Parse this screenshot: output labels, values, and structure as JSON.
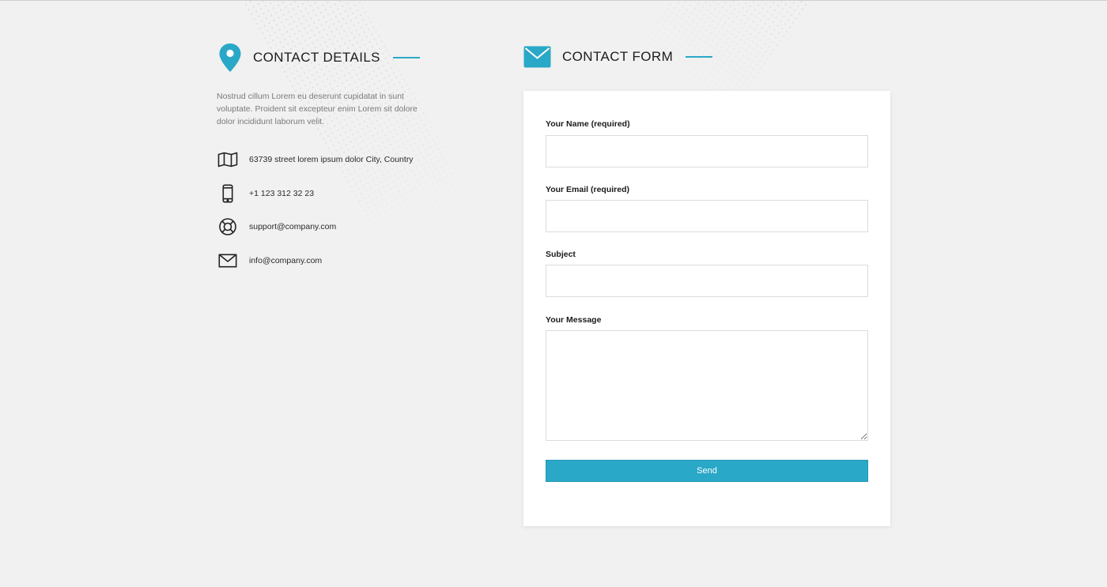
{
  "colors": {
    "accent": "#2aa8c7",
    "background": "#f1f1f1",
    "card": "#ffffff",
    "text_dark": "#1c1c1c",
    "text_muted": "#7a7a7a"
  },
  "contact_details": {
    "title": "CONTACT DETAILS",
    "icon": "map-pin-icon",
    "intro": "Nostrud cillum Lorem eu deserunt cupidatat in sunt voluptate. Proident sit excepteur enim Lorem sit dolore dolor incididunt laborum velit.",
    "items": [
      {
        "icon": "map-icon",
        "text": "63739 street lorem ipsum dolor City, Country"
      },
      {
        "icon": "mobile-phone-icon",
        "text": "+1 123 312 32 23"
      },
      {
        "icon": "lifebuoy-icon",
        "text": "support@company.com"
      },
      {
        "icon": "envelope-icon",
        "text": "info@company.com"
      }
    ]
  },
  "contact_form": {
    "title": "CONTACT FORM",
    "icon": "envelope-icon",
    "fields": {
      "name": {
        "label": "Your Name (required)",
        "value": ""
      },
      "email": {
        "label": "Your Email (required)",
        "value": ""
      },
      "subject": {
        "label": "Subject",
        "value": ""
      },
      "message": {
        "label": "Your Message",
        "value": ""
      }
    },
    "send_label": "Send"
  }
}
